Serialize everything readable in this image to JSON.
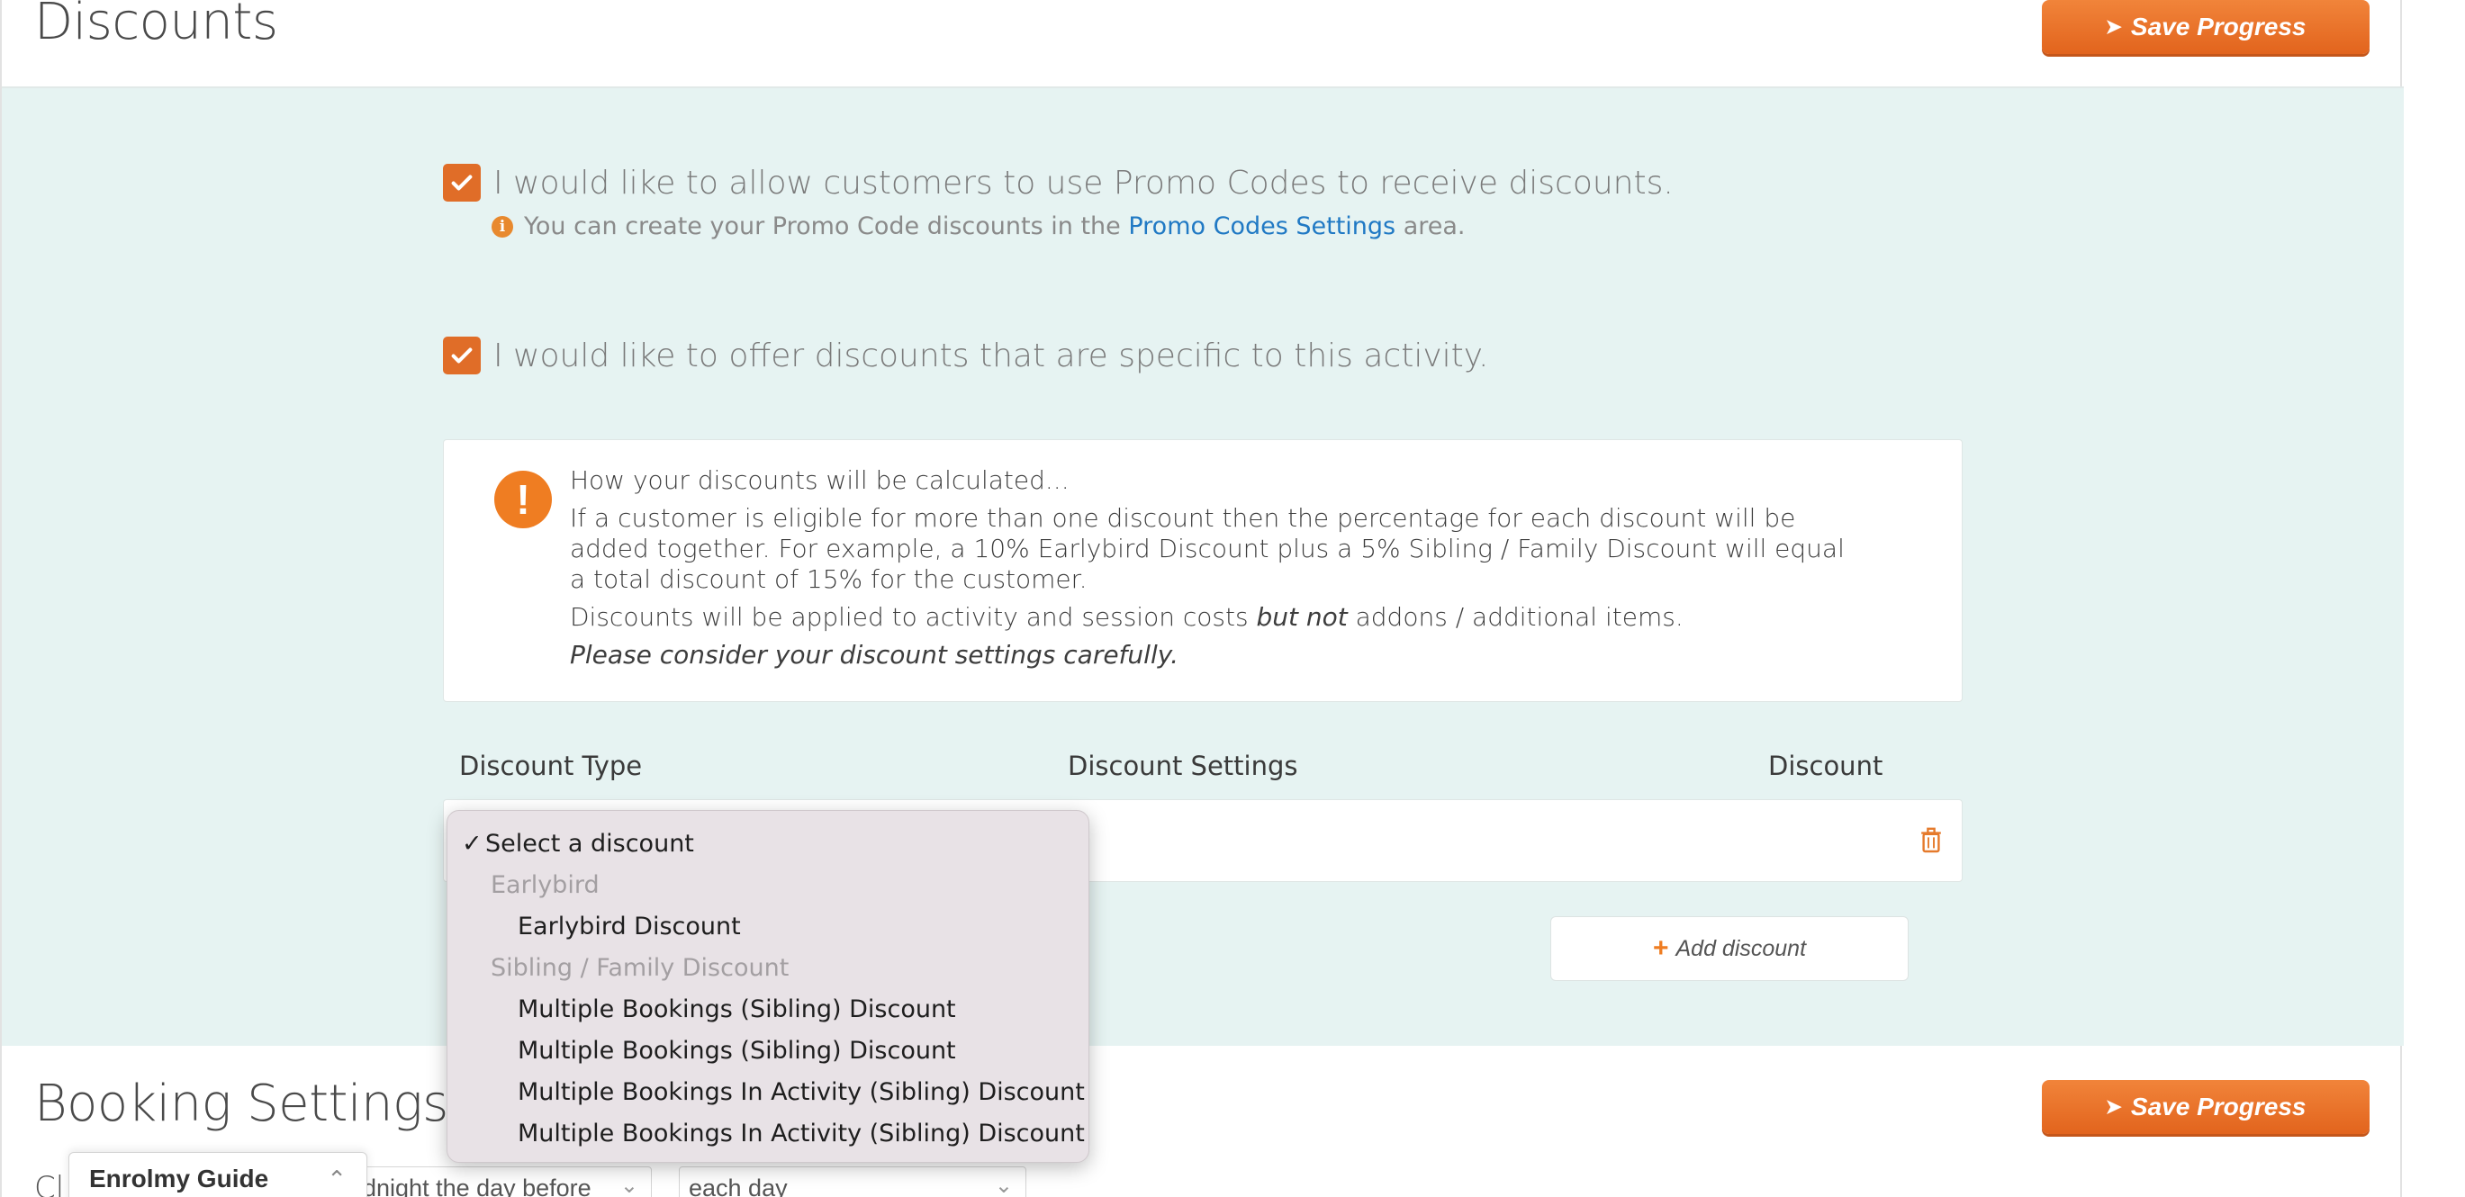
{
  "discounts_section": {
    "title": "Discounts",
    "save_label": "Save Progress"
  },
  "promo": {
    "checked": true,
    "label": "I would like to allow customers to use Promo Codes to receive discounts.",
    "hint_before": "You can create your Promo Code discounts in the",
    "hint_link": "Promo Codes Settings",
    "hint_after": "area."
  },
  "specific": {
    "checked": true,
    "label": "I would like to offer discounts that are specific to this activity."
  },
  "notice": {
    "heading": "How your discounts will be calculated...",
    "line1": "If a customer is eligible for more than one discount then the percentage for each discount will be added together. For example, a 10% Earlybird Discount plus a 5% Sibling / Family Discount will equal a total discount of 15% for the customer.",
    "line2_before": "Discounts will be applied to activity and session costs",
    "line2_em": "but not",
    "line2_after": "addons / additional items.",
    "line3": "Please consider your discount settings carefully."
  },
  "table": {
    "col_type": "Discount Type",
    "col_settings": "Discount Settings",
    "col_discount": "Discount"
  },
  "add_discount_label": "Add discount",
  "dropdown": {
    "selected": "Select a discount",
    "groups": [
      {
        "label": "Earlybird",
        "options": [
          "Earlybird Discount"
        ]
      },
      {
        "label": "Sibling / Family Discount",
        "options": [
          "Multiple Bookings (Sibling) Discount",
          "Multiple Bookings (Sibling) Discount",
          "Multiple Bookings In Activity (Sibling) Discount",
          "Multiple Bookings In Activity (Sibling) Discount"
        ]
      }
    ]
  },
  "booking_section": {
    "title": "Booking Settings",
    "save_label": "Save Progress",
    "prefix_text": "Cl",
    "select1_value": "dnight the day before",
    "select2_value": "each day"
  },
  "guide": {
    "label": "Enrolmy Guide"
  },
  "colors": {
    "accent": "#e06d28",
    "panel_bg": "#e6f3f2",
    "link": "#2079c4"
  }
}
